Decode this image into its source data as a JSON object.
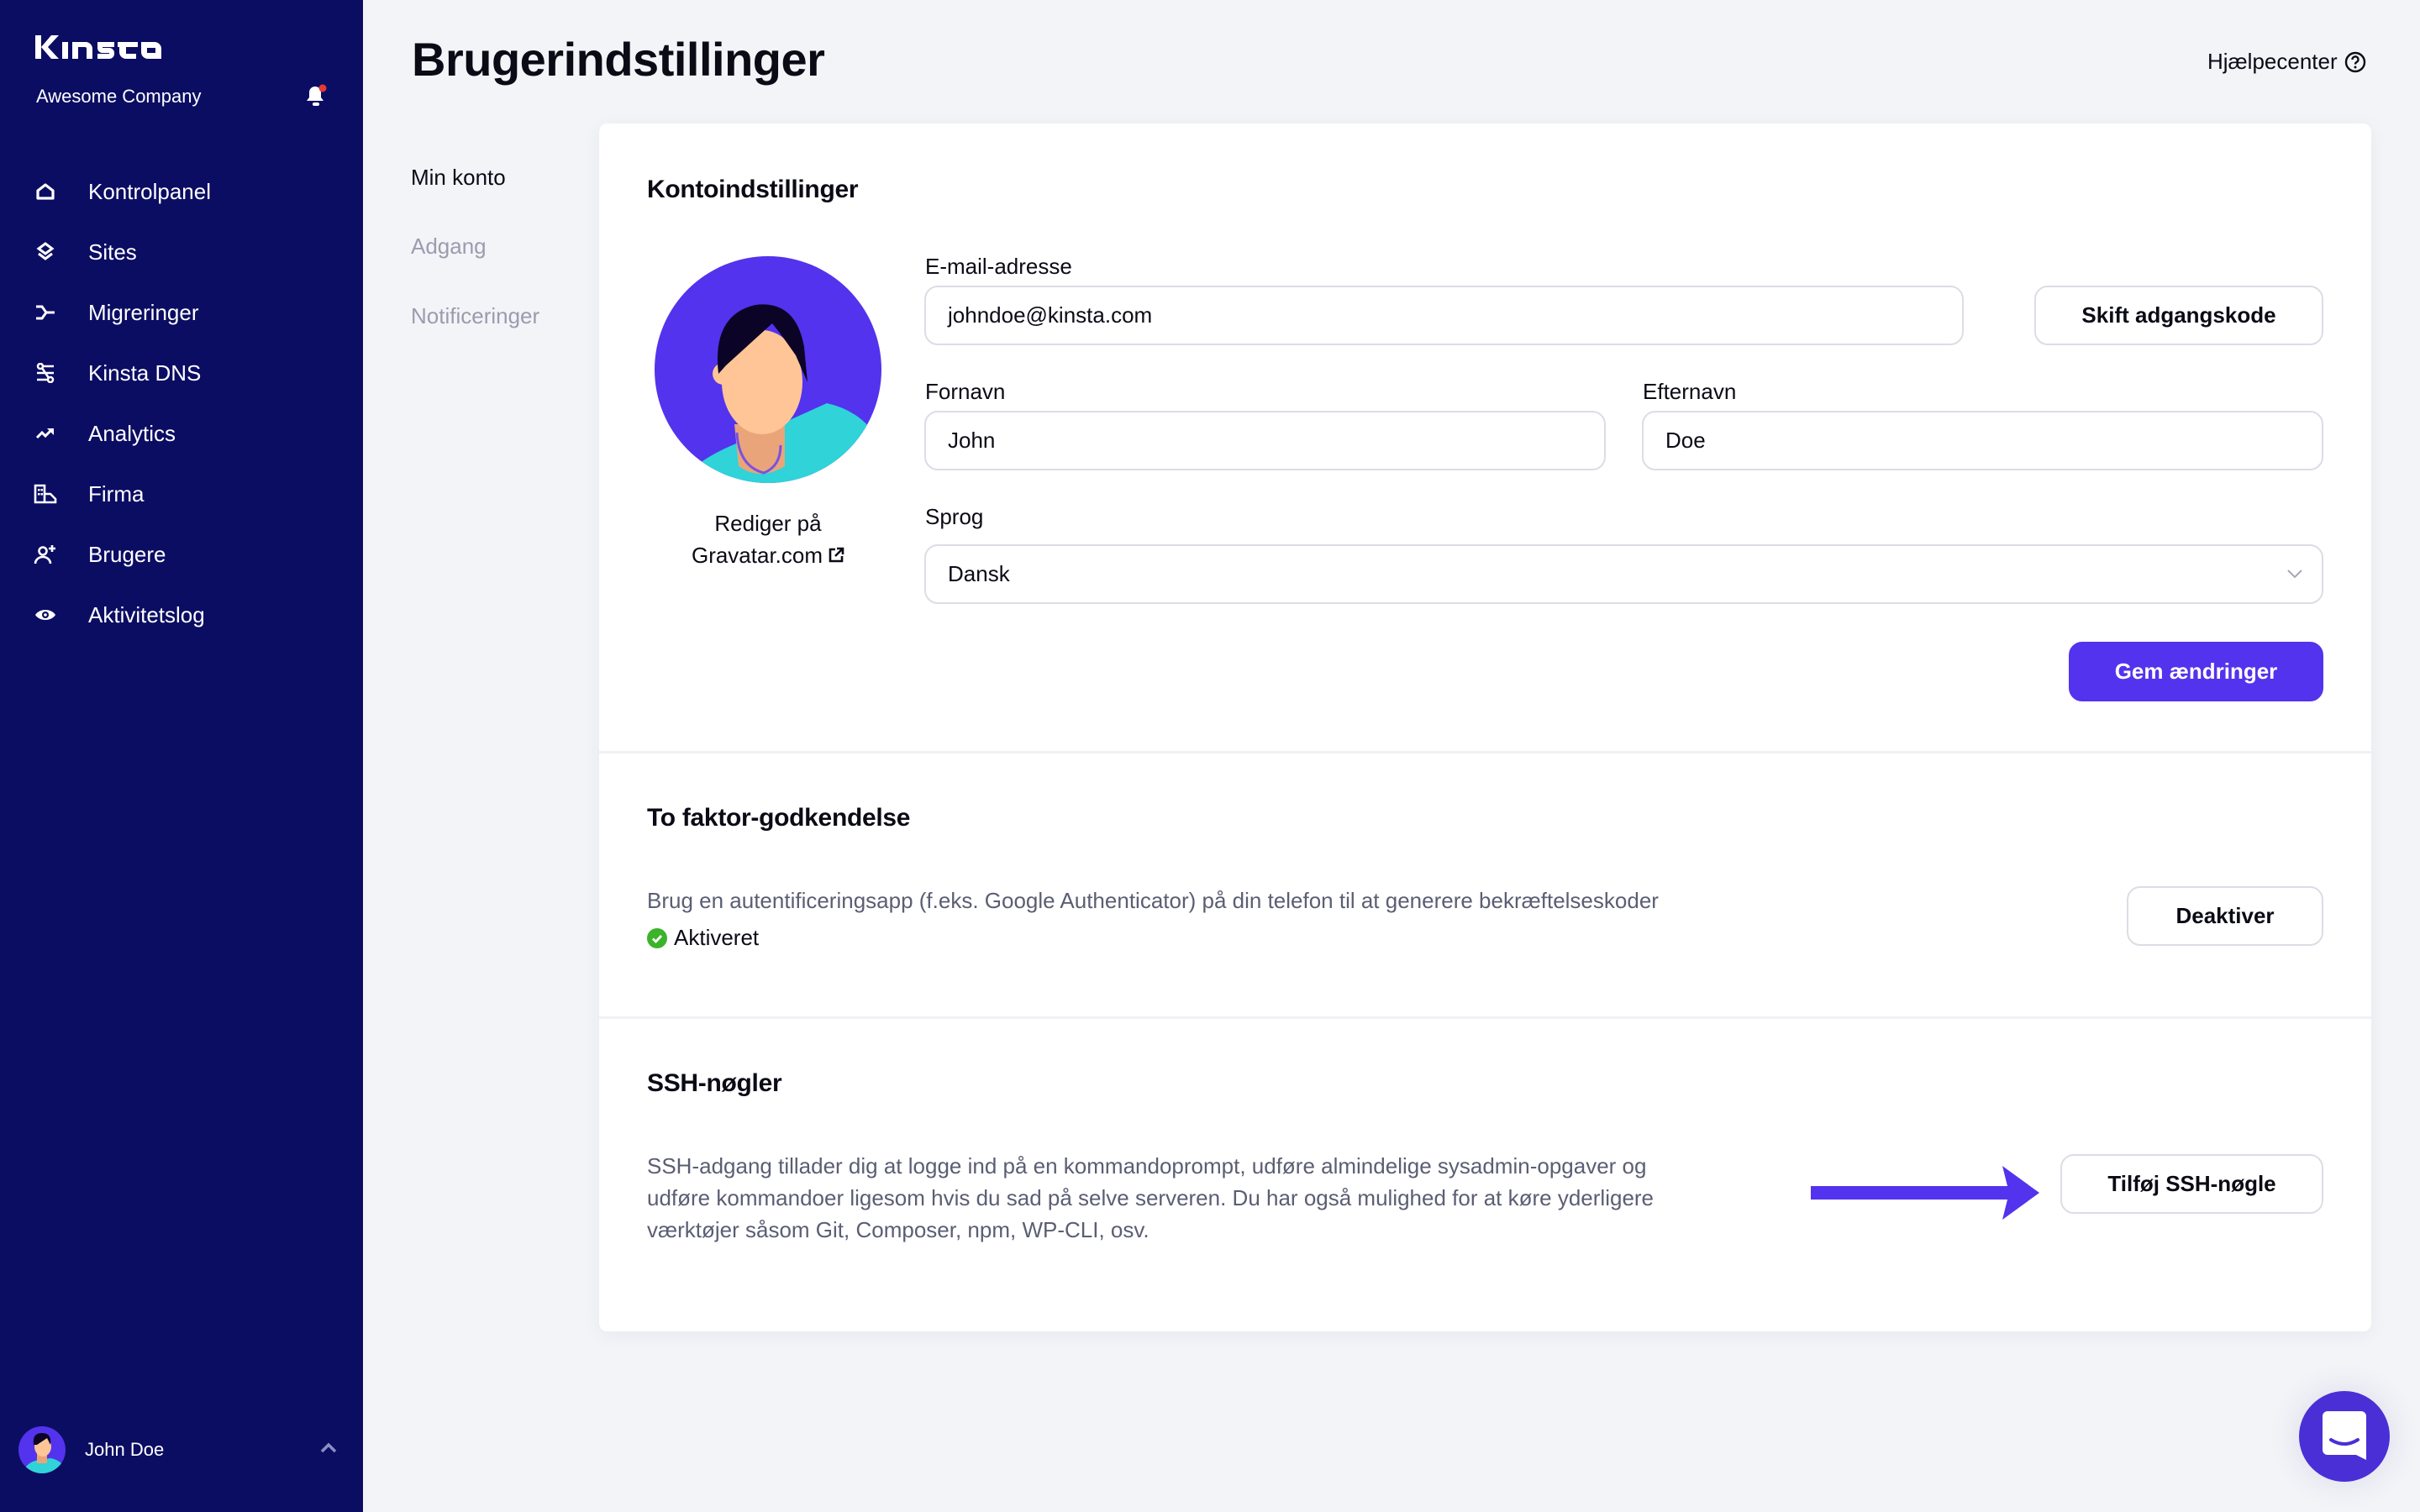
{
  "sidebar": {
    "brand": "kinsta",
    "company": "Awesome Company",
    "notification_dot_color": "#e53935",
    "items": [
      {
        "label": "Kontrolpanel",
        "icon": "home-icon"
      },
      {
        "label": "Sites",
        "icon": "layers-icon"
      },
      {
        "label": "Migreringer",
        "icon": "migration-icon"
      },
      {
        "label": "Kinsta DNS",
        "icon": "dns-icon"
      },
      {
        "label": "Analytics",
        "icon": "trending-up-icon"
      },
      {
        "label": "Firma",
        "icon": "building-icon"
      },
      {
        "label": "Brugere",
        "icon": "user-plus-icon"
      },
      {
        "label": "Aktivitetslog",
        "icon": "eye-icon"
      }
    ],
    "user": {
      "name": "John Doe"
    }
  },
  "header": {
    "title": "Brugerindstillinger",
    "help_label": "Hjælpecenter"
  },
  "subnav": {
    "items": [
      {
        "label": "Min konto",
        "active": true
      },
      {
        "label": "Adgang",
        "active": false
      },
      {
        "label": "Notificeringer",
        "active": false
      }
    ]
  },
  "account": {
    "title": "Kontoindstillinger",
    "gravatar_line1": "Rediger på",
    "gravatar_line2": "Gravatar.com",
    "email_label": "E-mail-adresse",
    "email_value": "johndoe@kinsta.com",
    "change_password_label": "Skift adgangskode",
    "first_name_label": "Fornavn",
    "first_name_value": "John",
    "last_name_label": "Efternavn",
    "last_name_value": "Doe",
    "language_label": "Sprog",
    "language_value": "Dansk",
    "save_label": "Gem ændringer"
  },
  "two_factor": {
    "title": "To faktor-godkendelse",
    "description": "Brug en autentificeringsapp (f.eks. Google Authenticator) på din telefon til at generere bekræftelseskoder",
    "status": "Aktiveret",
    "status_color": "#3bb32a",
    "button_label": "Deaktiver"
  },
  "ssh": {
    "title": "SSH-nøgler",
    "description": "SSH-adgang tillader dig at logge ind på en kommandoprompt, udføre almindelige sysadmin-opgaver og udføre kommandoer ligesom hvis du sad på selve serveren. Du har også mulighed for at køre yderligere værktøjer såsom Git, Composer, npm, WP-CLI, osv.",
    "button_label": "Tilføj SSH-nøgle"
  },
  "colors": {
    "sidebar": "#0b0d63",
    "accent": "#5333ed",
    "background": "#f3f4f8"
  }
}
